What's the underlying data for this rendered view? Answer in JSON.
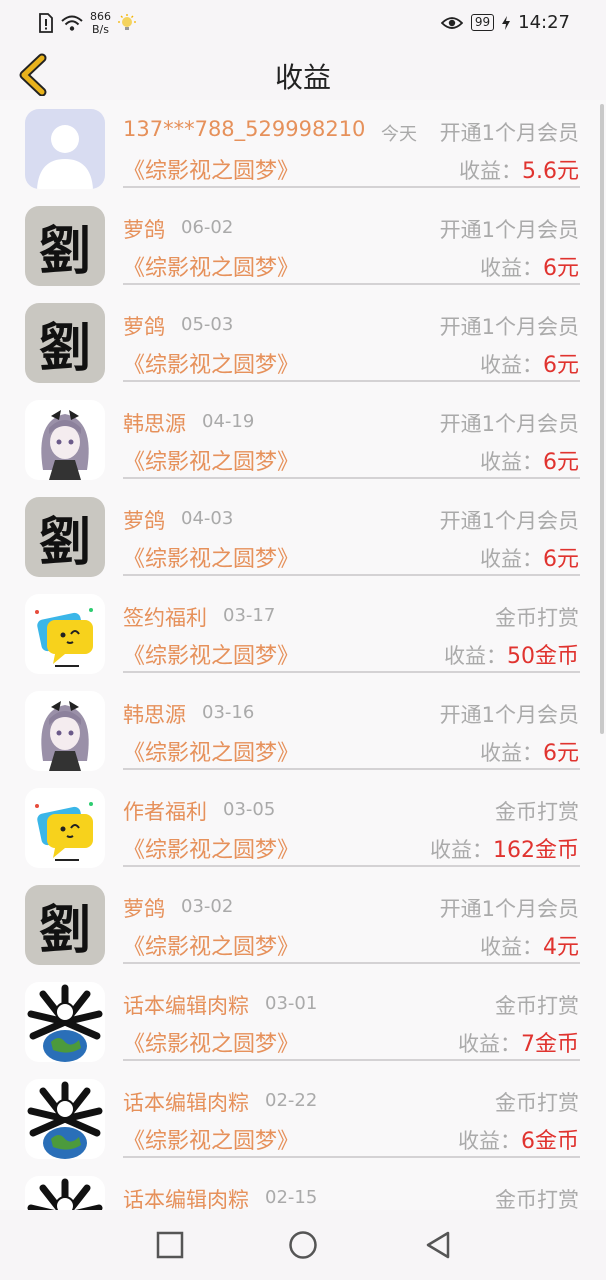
{
  "status": {
    "net_speed_top": "866",
    "net_speed_bottom": "B/s",
    "battery": "99",
    "time": "14:27"
  },
  "header": {
    "title": "收益"
  },
  "rows": [
    {
      "avatar": "default-user-avatar",
      "name": "137***788_529998210",
      "date": "今天",
      "type": "开通1个月会员",
      "book": "《综影视之圆梦》",
      "earn_label": "收益：",
      "amount": "5.6元"
    },
    {
      "avatar": "liu-character-avatar",
      "name": "萝鸽",
      "date": "06-02",
      "type": "开通1个月会员",
      "book": "《综影视之圆梦》",
      "earn_label": "收益：",
      "amount": "6元"
    },
    {
      "avatar": "liu-character-avatar",
      "name": "萝鸽",
      "date": "05-03",
      "type": "开通1个月会员",
      "book": "《综影视之圆梦》",
      "earn_label": "收益：",
      "amount": "6元"
    },
    {
      "avatar": "anime-girl-avatar",
      "name": "韩思源",
      "date": "04-19",
      "type": "开通1个月会员",
      "book": "《综影视之圆梦》",
      "earn_label": "收益：",
      "amount": "6元"
    },
    {
      "avatar": "liu-character-avatar",
      "name": "萝鸽",
      "date": "04-03",
      "type": "开通1个月会员",
      "book": "《综影视之圆梦》",
      "earn_label": "收益：",
      "amount": "6元"
    },
    {
      "avatar": "chat-bubble-avatar",
      "name": "签约福利",
      "date": "03-17",
      "type": "金币打赏",
      "book": "《综影视之圆梦》",
      "earn_label": "收益：",
      "amount": "50金币"
    },
    {
      "avatar": "anime-girl-avatar",
      "name": "韩思源",
      "date": "03-16",
      "type": "开通1个月会员",
      "book": "《综影视之圆梦》",
      "earn_label": "收益：",
      "amount": "6元"
    },
    {
      "avatar": "chat-bubble-avatar",
      "name": "作者福利",
      "date": "03-05",
      "type": "金币打赏",
      "book": "《综影视之圆梦》",
      "earn_label": "收益：",
      "amount": "162金币"
    },
    {
      "avatar": "liu-character-avatar",
      "name": "萝鸽",
      "date": "03-02",
      "type": "开通1个月会员",
      "book": "《综影视之圆梦》",
      "earn_label": "收益：",
      "amount": "4元"
    },
    {
      "avatar": "globe-avatar",
      "name": "话本编辑肉粽",
      "date": "03-01",
      "type": "金币打赏",
      "book": "《综影视之圆梦》",
      "earn_label": "收益：",
      "amount": "7金币"
    },
    {
      "avatar": "globe-avatar",
      "name": "话本编辑肉粽",
      "date": "02-22",
      "type": "金币打赏",
      "book": "《综影视之圆梦》",
      "earn_label": "收益：",
      "amount": "6金币"
    },
    {
      "avatar": "globe-avatar",
      "name": "话本编辑肉粽",
      "date": "02-15",
      "type": "金币打赏",
      "book": "",
      "earn_label": "",
      "amount": ""
    }
  ],
  "avatar_glyph_liu": "劉",
  "colors": {
    "accent": "#e6915b",
    "amount": "#e0332f",
    "back_arrow": "#e8b21c"
  }
}
